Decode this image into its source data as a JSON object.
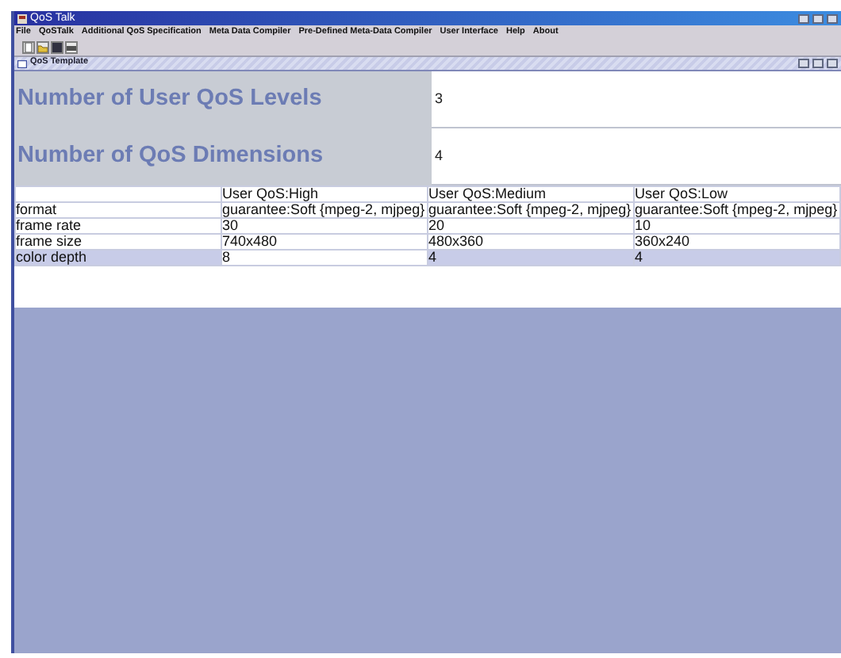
{
  "window": {
    "title": "QoS Talk"
  },
  "menu": [
    "File",
    "QoSTalk",
    "Additional QoS Specification",
    "Meta Data Compiler",
    "Pre-Defined Meta-Data Compiler",
    "User Interface",
    "Help",
    "About"
  ],
  "internal_frame": {
    "title": "QoS Template"
  },
  "settings": [
    {
      "label": "Number of User QoS Levels",
      "value": "3"
    },
    {
      "label": "Number of QoS Dimensions",
      "value": "4"
    }
  ],
  "table": {
    "columns": [
      "",
      "User QoS:High",
      "User QoS:Medium",
      "User QoS:Low"
    ],
    "rows": [
      {
        "cells": [
          "format",
          "guarantee:Soft {mpeg-2, mjpeg}",
          "guarantee:Soft {mpeg-2, mjpeg}",
          "guarantee:Soft {mpeg-2, mjpeg}"
        ],
        "selected": false
      },
      {
        "cells": [
          "frame rate",
          "30",
          "20",
          "10"
        ],
        "selected": false
      },
      {
        "cells": [
          "frame size",
          "740x480",
          "480x360",
          "360x240"
        ],
        "selected": false
      },
      {
        "cells": [
          "color depth",
          "8",
          "4",
          "4"
        ],
        "selected": true
      }
    ]
  }
}
